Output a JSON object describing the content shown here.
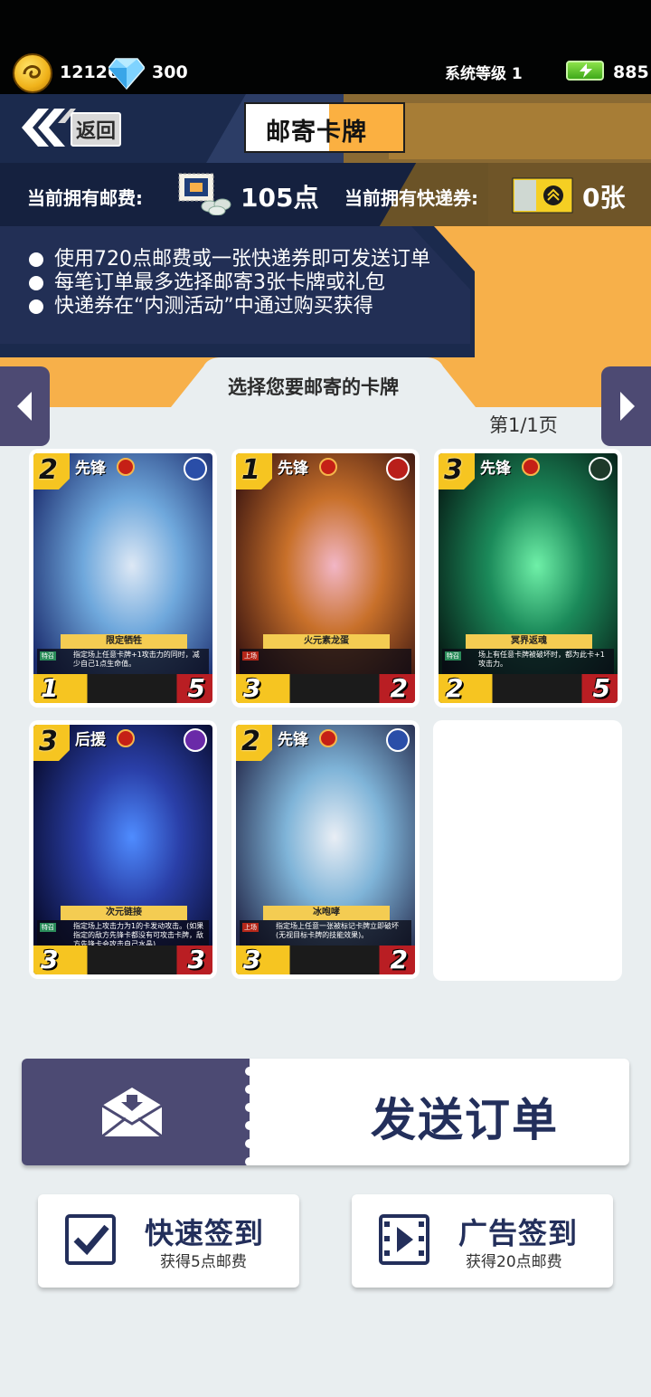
{
  "currency": {
    "gold": "12126",
    "diamonds": "300",
    "system_level": "系统等级 1",
    "energy": "885"
  },
  "header": {
    "back_label": "返回",
    "title_a": "邮寄",
    "title_b": "卡牌"
  },
  "postage": {
    "fee_label": "当前拥有邮费:",
    "fee_value": "105点",
    "voucher_label": "当前拥有快递券:",
    "voucher_value": "0张"
  },
  "rules": [
    "使用720点邮费或一张快递券即可发送订单",
    "每笔订单最多选择邮寄3张卡牌或礼包",
    "快递券在“内测活动”中通过购买获得"
  ],
  "selection": {
    "title": "选择您要邮寄的卡牌",
    "page": "第1/1页"
  },
  "cards": [
    {
      "cost": "2",
      "role": "先锋",
      "name": "限定牺牲",
      "tag": "特召",
      "desc": "指定场上任意卡牌+1攻击力的同时，减少自己1点生命值。",
      "atk": "1",
      "hp": "5",
      "palette": [
        "#1a2a6c",
        "#6fa8dc",
        "#dde8f5"
      ],
      "elem_color": "#2a4ea8"
    },
    {
      "cost": "1",
      "role": "先锋",
      "name": "火元素龙蛋",
      "tag": "上场",
      "desc": "",
      "atk": "3",
      "hp": "2",
      "palette": [
        "#3a1410",
        "#c8702a",
        "#f2b6c6"
      ],
      "elem_color": "#b91f1a"
    },
    {
      "cost": "3",
      "role": "先锋",
      "name": "冥界返魂",
      "tag": "特召",
      "desc": "场上有任意卡牌被破坏时，都为此卡+1攻击力。",
      "atk": "2",
      "hp": "5",
      "palette": [
        "#061a14",
        "#1b8a5a",
        "#6ff0a8"
      ],
      "elem_color": "#1e3a2a"
    },
    {
      "cost": "3",
      "role": "后援",
      "name": "次元链接",
      "tag": "特召",
      "desc": "指定场上攻击力为1的卡发动攻击。(如果指定的敌方先锋卡都没有可攻击卡牌，敌方先锋卡会攻击自己水晶)",
      "atk": "3",
      "hp": "3",
      "palette": [
        "#070a2a",
        "#2a3fa8",
        "#4f8cff"
      ],
      "elem_color": "#6a2aa8"
    },
    {
      "cost": "2",
      "role": "先锋",
      "name": "冰咆哮",
      "tag": "上场",
      "desc": "指定场上任意一张被标记卡牌立即破坏(无视目标卡牌的技能效果)。",
      "atk": "3",
      "hp": "2",
      "palette": [
        "#23284a",
        "#7fb4d8",
        "#e9eef5"
      ],
      "elem_color": "#2a4ea8"
    }
  ],
  "actions": {
    "send_label": "发送订单",
    "quick_checkin": {
      "title": "快速签到",
      "sub": "获得5点邮费"
    },
    "ad_checkin": {
      "title": "广告签到",
      "sub": "获得20点邮费"
    }
  },
  "colors": {
    "navy": "#1b2a4d",
    "gold": "#f7b04a",
    "purple": "#4c4a73",
    "text_navy": "#232f5b"
  }
}
